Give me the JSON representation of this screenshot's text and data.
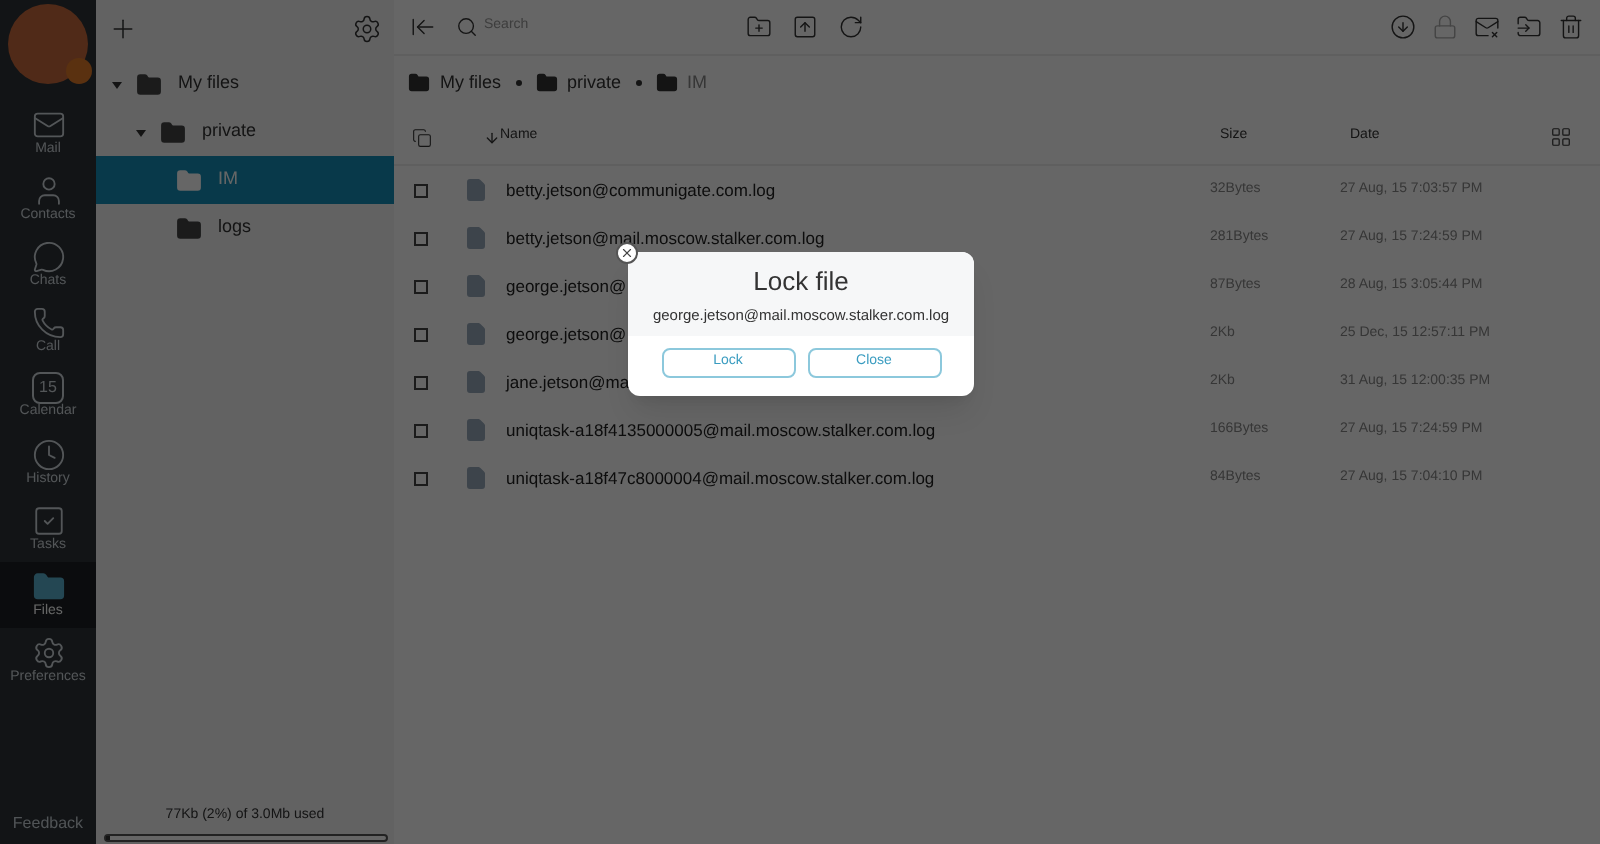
{
  "nav": {
    "items": [
      {
        "label": "Mail",
        "kind": "mail",
        "selected": false
      },
      {
        "label": "Contacts",
        "kind": "contacts",
        "selected": false
      },
      {
        "label": "Chats",
        "kind": "chats",
        "selected": false
      },
      {
        "label": "Call",
        "kind": "call",
        "selected": false
      },
      {
        "label": "Calendar",
        "kind": "calendar",
        "day": "15",
        "selected": false
      },
      {
        "label": "History",
        "kind": "history",
        "selected": false
      },
      {
        "label": "Tasks",
        "kind": "tasks",
        "selected": false
      },
      {
        "label": "Files",
        "kind": "files",
        "selected": true
      },
      {
        "label": "Preferences",
        "kind": "preferences",
        "selected": false
      }
    ],
    "feedback": "Feedback"
  },
  "folders": {
    "tree": [
      {
        "label": "My files",
        "expanded": true,
        "selected": false,
        "children": [
          {
            "label": "private",
            "expanded": true,
            "selected": false,
            "children": [
              {
                "label": "IM",
                "selected": true
              },
              {
                "label": "logs",
                "selected": false
              }
            ]
          }
        ]
      }
    ],
    "storage": {
      "text": "77Kb (2%) of 3.0Mb used",
      "level": 0.02
    }
  },
  "toolbar": {
    "search": {
      "placeholder": "Search"
    }
  },
  "breadcrumb": [
    "My files",
    "private",
    "IM"
  ],
  "table": {
    "columns": [
      "Name",
      "Size",
      "Date"
    ],
    "rows": [
      {
        "name": "betty.jetson@communigate.com.log",
        "size": "32Bytes",
        "date": "27 Aug, 15 7:03:57 PM",
        "checked": false
      },
      {
        "name": "betty.jetson@mail.moscow.stalker.com.log",
        "size": "281Bytes",
        "date": "27 Aug, 15 7:24:59 PM",
        "checked": false
      },
      {
        "name": "george.jetson@",
        "size": "87Bytes",
        "date": "28 Aug, 15 3:05:44 PM",
        "checked": false
      },
      {
        "name": "george.jetson@",
        "size": "2Kb",
        "date": "25 Dec, 15 12:57:11 PM",
        "checked": false
      },
      {
        "name": "jane.jetson@ma",
        "size": "2Kb",
        "date": "31 Aug, 15 12:00:35 PM",
        "checked": false
      },
      {
        "name": "uniqtask-a18f4135000005@mail.moscow.stalker.com.log",
        "size": "166Bytes",
        "date": "27 Aug, 15 7:24:59 PM",
        "checked": false
      },
      {
        "name": "uniqtask-a18f47c8000004@mail.moscow.stalker.com.log",
        "size": "84Bytes",
        "date": "27 Aug, 15 7:04:10 PM",
        "checked": false
      }
    ]
  },
  "dialog": {
    "title": "Lock file",
    "message": "george.jetson@mail.moscow.stalker.com.log",
    "buttons": [
      "Lock",
      "Close"
    ]
  }
}
